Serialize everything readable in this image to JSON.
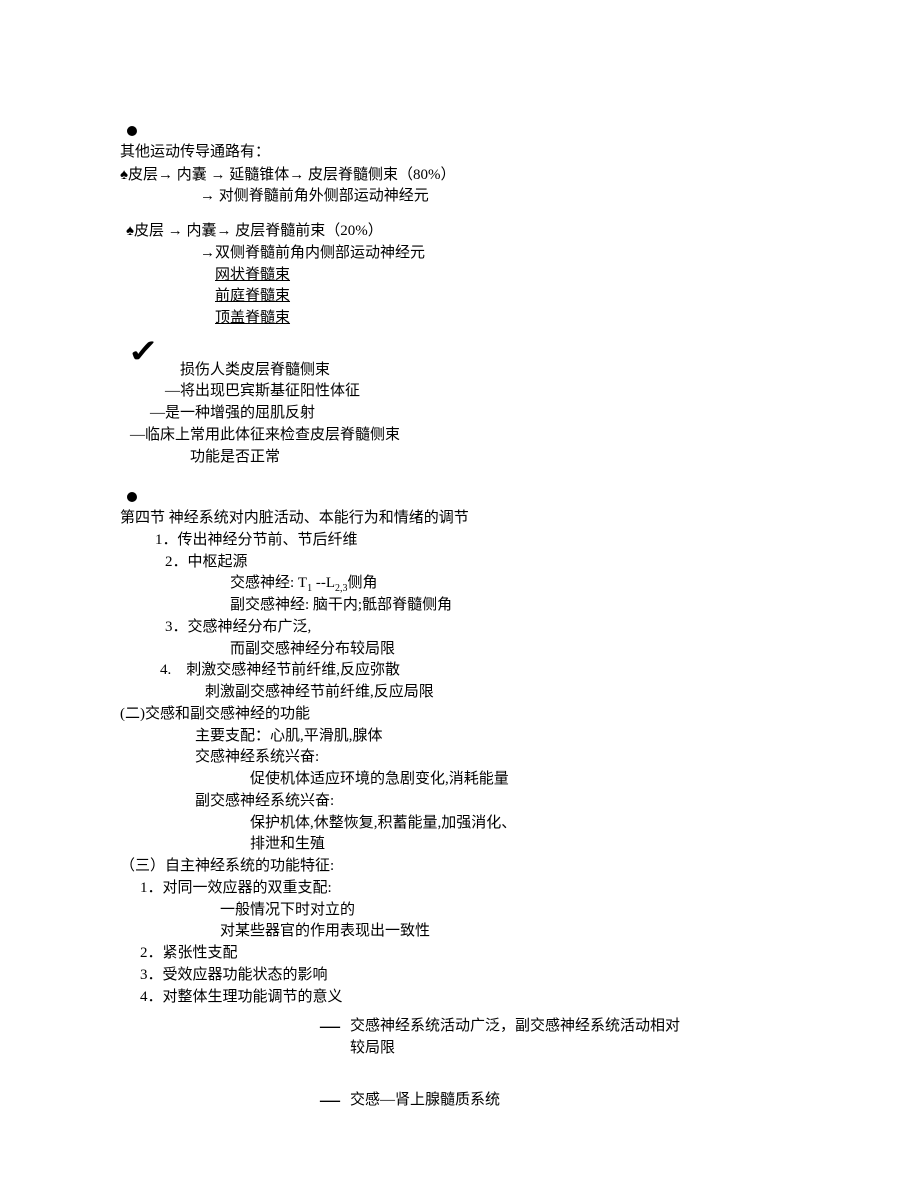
{
  "section1": {
    "heading": "其他运动传导通路有：",
    "path1a": "皮层→  内囊  →  延髓锥体→  皮层脊髓侧束（80%）",
    "path1b": "→ 对侧脊髓前角外侧部运动神经元",
    "path2a": "皮层  →  内囊→  皮层脊髓前束（20%）",
    "path2b": "→双侧脊髓前角内侧部运动神经元",
    "ul1": "网状脊髓束",
    "ul2": "前庭脊髓束",
    "ul3": "顶盖脊髓束"
  },
  "injury": {
    "l1": "损伤人类皮层脊髓侧束",
    "l2": "—将出现巴宾斯基征阳性体征",
    "l3": "—是一种增强的屈肌反射",
    "l4": "—临床上常用此体征来检查皮层脊髓侧束",
    "l5": "功能是否正常"
  },
  "section4": {
    "title": "第四节  神经系统对内脏活动、本能行为和情绪的调节",
    "item1": "传出神经分节前、节后纤维",
    "item2": "中枢起源",
    "item2a_pre": "交感神经: T",
    "item2a_sub1": "1",
    "item2a_mid": " --L",
    "item2a_sub2": "2,3",
    "item2a_post": "侧角",
    "item2b": "副交感神经:  脑干内;骶部脊髓侧角",
    "item3a": "交感神经分布广泛,",
    "item3b": "而副交感神经分布较局限",
    "item4a": "刺激交感神经节前纤维,反应弥散",
    "item4b": "刺激副交感神经节前纤维,反应局限"
  },
  "part2": {
    "heading": "(二)交感和副交感神经的功能",
    "l1": "主要支配：心肌,平滑肌,腺体",
    "l2": "交感神经系统兴奋:",
    "l2a": "促使机体适应环境的急剧变化,消耗能量",
    "l3": "副交感神经系统兴奋:",
    "l3a": "保护机体,休整恢复,积蓄能量,加强消化、",
    "l3b": "排泄和生殖"
  },
  "part3": {
    "heading": "（三）自主神经系统的功能特征:",
    "i1": "对同一效应器的双重支配:",
    "i1a": "一般情况下时对立的",
    "i1b": "对某些器官的作用表现出一致性",
    "i2": "紧张性支配",
    "i3": "受效应器功能状态的影响",
    "i4": "对整体生理功能调节的意义"
  },
  "boxes": {
    "b1": "交感神经系统活动广泛，副交感神经系统活动相对较局限",
    "b2": "交感—肾上腺髓质系统"
  }
}
